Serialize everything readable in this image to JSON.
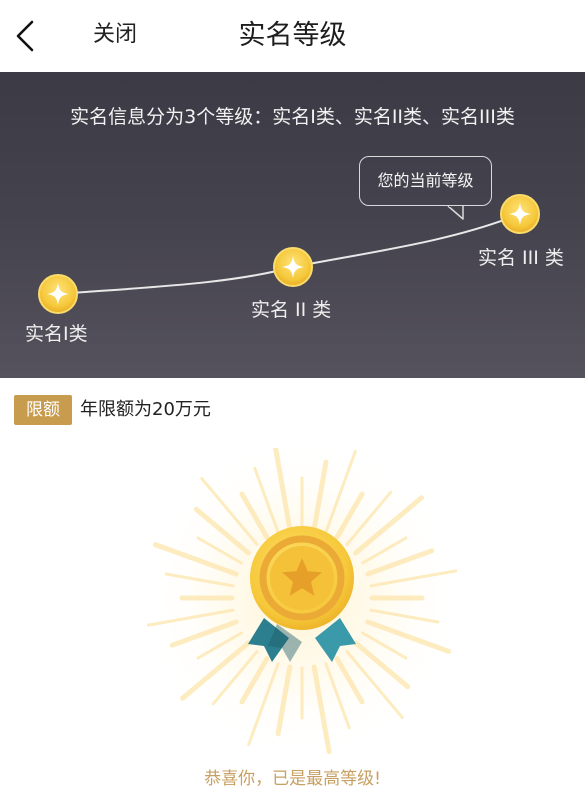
{
  "header": {
    "back_icon": "chevron-left-icon",
    "close_label": "关闭",
    "title": "实名等级"
  },
  "levels": {
    "intro": "实名信息分为3个等级：实名I类、实名II类、实名III类",
    "tooltip": "您的当前等级",
    "items": [
      {
        "label": "实名I类",
        "icon": "star-coin-icon"
      },
      {
        "label": "实名 II 类",
        "icon": "star-coin-icon"
      },
      {
        "label": "实名 III 类",
        "icon": "star-coin-icon"
      }
    ],
    "current_level_index": 2,
    "colors": {
      "panel_top": "#3c3a44",
      "panel_bottom": "#55525d",
      "coin": "#f7cf46",
      "line": "#e8e8e8"
    }
  },
  "limit": {
    "badge": "限额",
    "text": "年限额为20万元",
    "badge_color": "#c79c4e"
  },
  "medal": {
    "icon": "medal-icon",
    "message": "恭喜你，已是最高等级!",
    "colors": {
      "gold": "#f6cf45",
      "gold_dark": "#eab233",
      "ribbon": "#2f8a9a"
    }
  }
}
